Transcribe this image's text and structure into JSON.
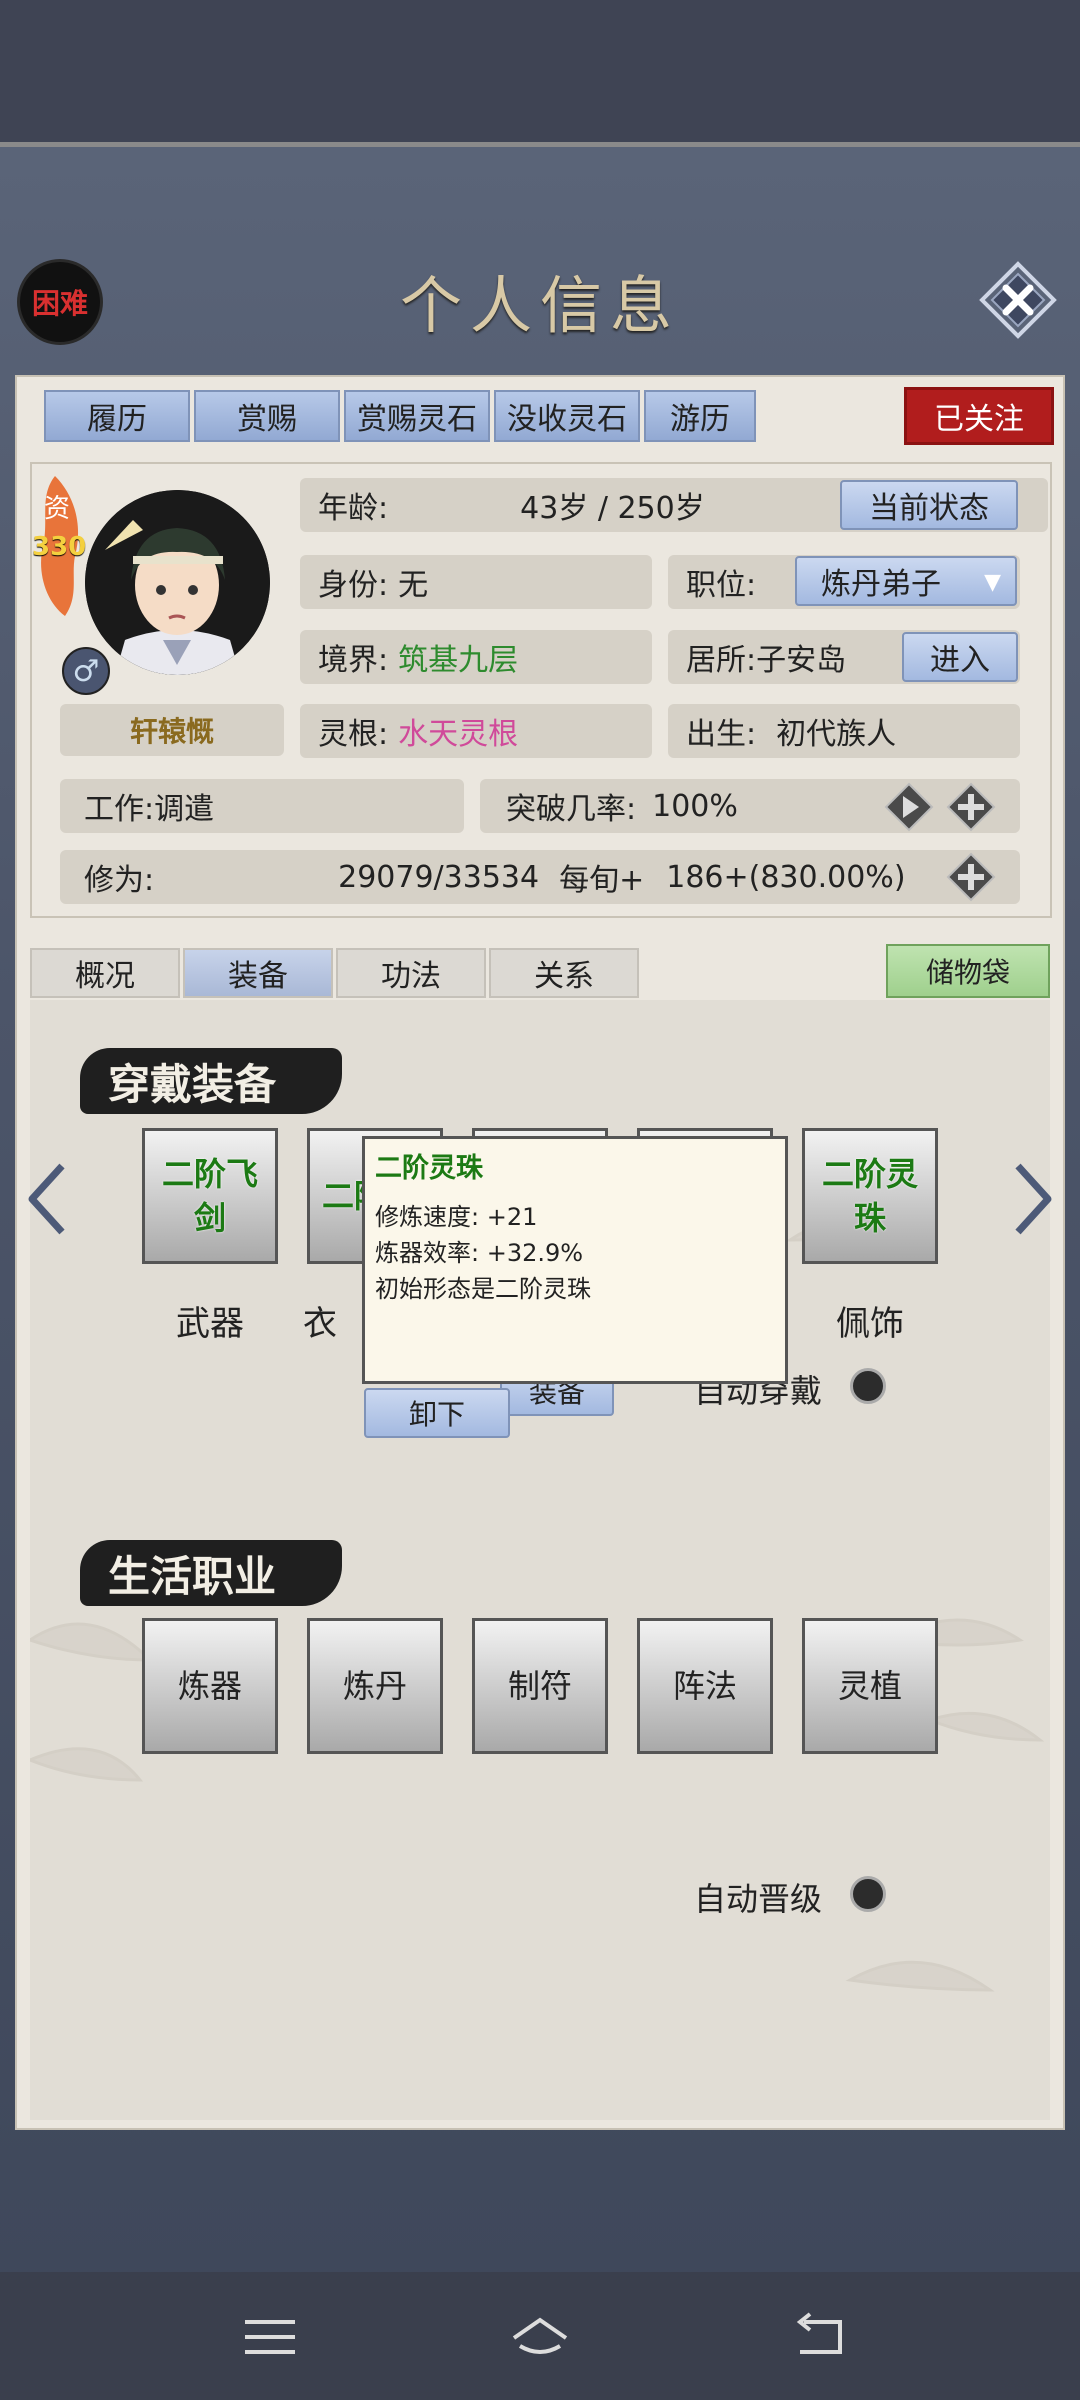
{
  "header": {
    "difficulty": "困难",
    "title": "个人信息"
  },
  "tabs": [
    "履历",
    "赏赐",
    "赏赐灵石",
    "没收灵石",
    "游历"
  ],
  "follow_label": "已关注",
  "profile": {
    "aptitude_label": "资",
    "aptitude_value": "330",
    "gender_symbol": "♂",
    "name": "轩辕慨",
    "age_label": "年龄:",
    "age_value": "43岁 / 250岁",
    "current_state_button": "当前状态",
    "identity_label": "身份:",
    "identity_value": "无",
    "position_label": "职位:",
    "position_value": "炼丹弟子",
    "realm_label": "境界:",
    "realm_value": "筑基九层",
    "residence_label": "居所:",
    "residence_value": "子安岛",
    "enter_button": "进入",
    "root_label": "灵根:",
    "root_value": "水天灵根",
    "birth_label": "出生:",
    "birth_value": "初代族人",
    "work_label": "工作:",
    "work_value": "调遣",
    "breakthrough_label": "突破几率:",
    "breakthrough_value": "100%",
    "cultivation_label": "修为:",
    "cultivation_value": "29079/33534",
    "per_turn_label": "每旬+",
    "per_turn_value": "186+(830.00%)"
  },
  "subtabs": [
    "概况",
    "装备",
    "功法",
    "关系"
  ],
  "active_subtab": "装备",
  "bag_label": "储物袋",
  "equip_section": {
    "title": "穿戴装备",
    "slots": [
      {
        "item": "二阶飞剑",
        "label": "武器"
      },
      {
        "item": "二阶",
        "label": "衣"
      },
      {
        "item": "",
        "label": ""
      },
      {
        "item": "",
        "label": ""
      },
      {
        "item": "二阶灵珠",
        "label": "佩饰"
      }
    ],
    "auto_wear_label": "自动穿戴",
    "equip_button_partial": "装备",
    "unequip_button": "卸下"
  },
  "tooltip": {
    "title": "二阶灵珠",
    "line1": "修炼速度: +21",
    "line2": "炼器效率: +32.9%",
    "line3": "初始形态是二阶灵珠"
  },
  "life_section": {
    "title": "生活职业",
    "jobs": [
      "炼器",
      "炼丹",
      "制符",
      "阵法",
      "灵植"
    ],
    "auto_upgrade_label": "自动晋级"
  },
  "colors": {
    "accent_blue": "#a3b9e0",
    "follow_red": "#b11d1d",
    "equip_green": "#1c7a14",
    "root_pink": "#d04a9a",
    "realm_green": "#2e8b2e"
  }
}
